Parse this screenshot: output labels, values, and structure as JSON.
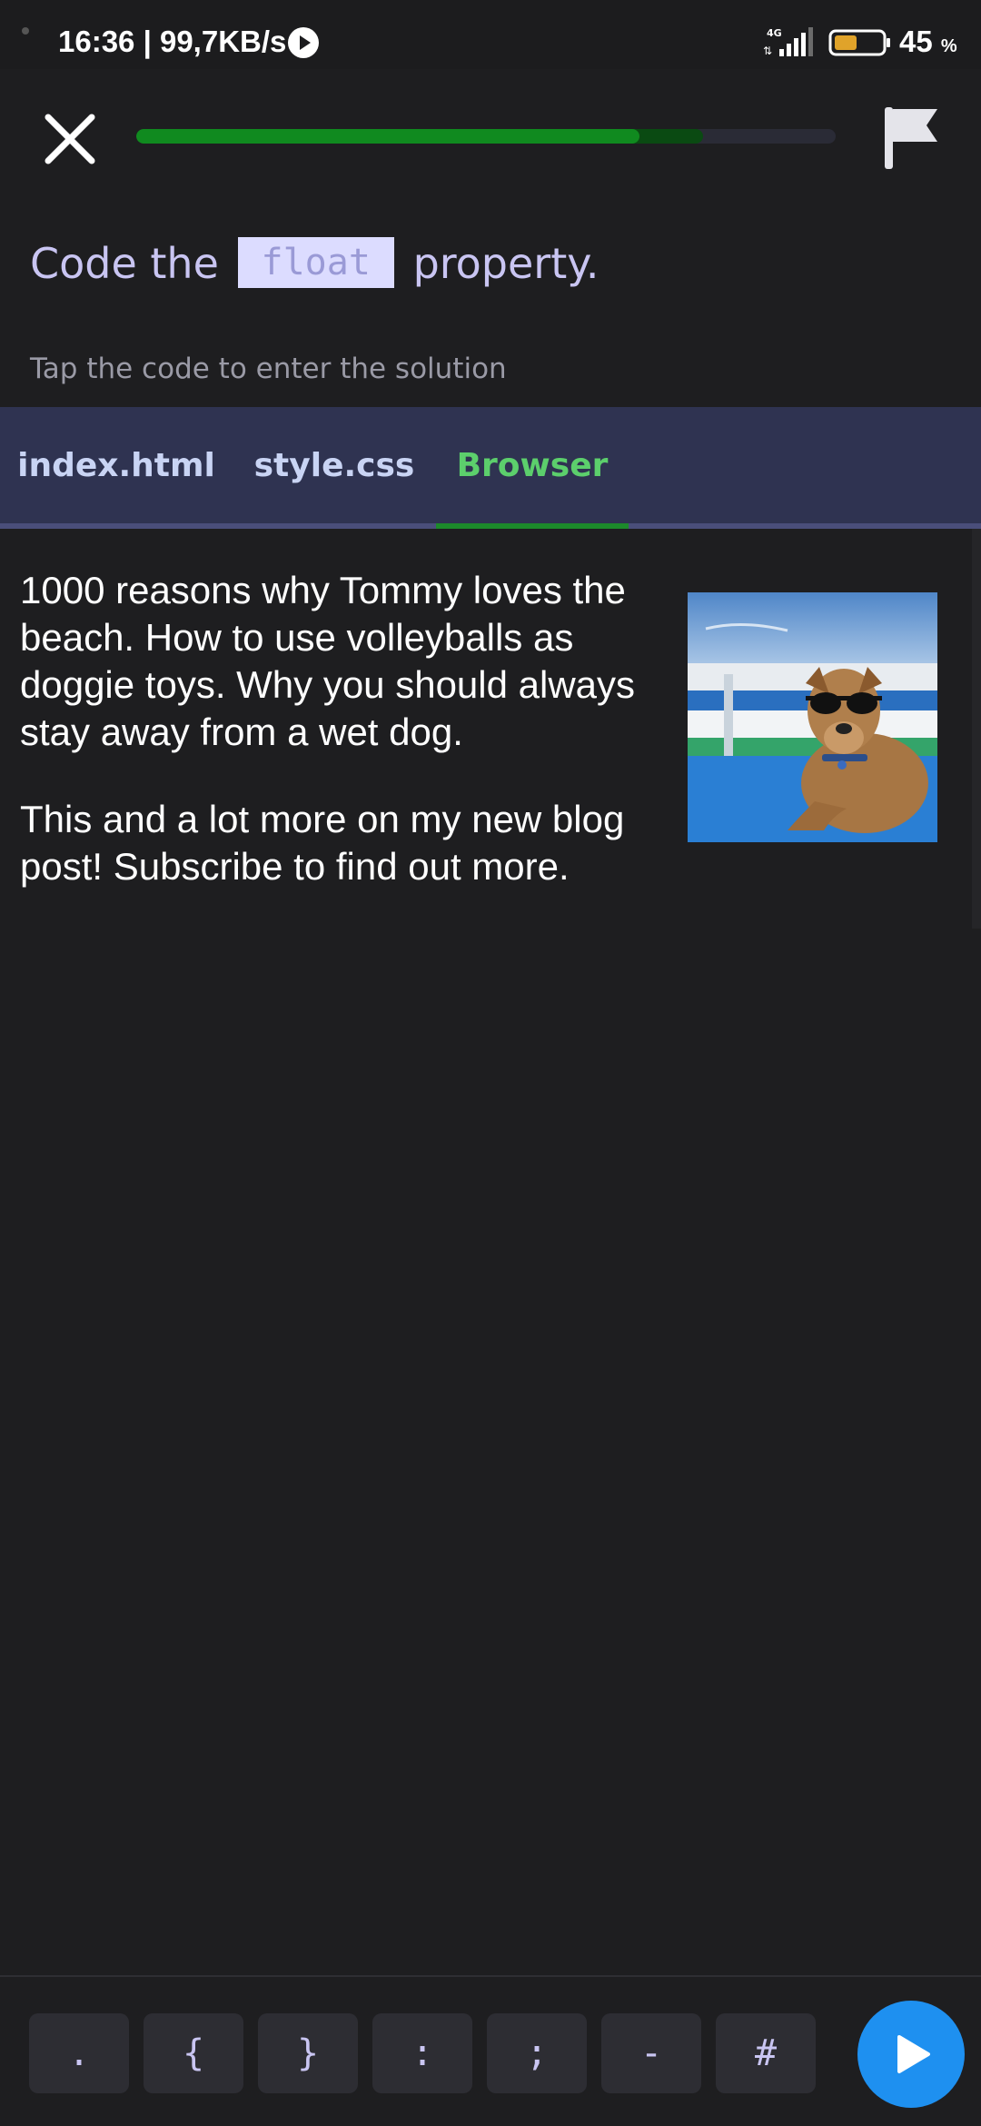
{
  "status_bar": {
    "time_text": "16:36 | 99,7KB/s",
    "network_label": "4G",
    "battery_percent": "45",
    "battery_unit": "%"
  },
  "toolbar": {
    "progress_fraction": 0.72,
    "progress_secondary_fraction": 0.81,
    "accent_color": "#108a1f"
  },
  "question": {
    "prefix": "Code the",
    "code": "float",
    "suffix": "property."
  },
  "hint": "Tap the code to enter the solution",
  "tabs": [
    {
      "label": "index.html",
      "active": false
    },
    {
      "label": "style.css",
      "active": false
    },
    {
      "label": "Browser",
      "active": true
    }
  ],
  "browser": {
    "paragraphs": [
      "1000 reasons why Tommy loves the beach. How to use volleyballs as doggie toys. Why you should always stay away from a wet dog.",
      "This and a lot more on my new blog post! Subscribe to find out more."
    ]
  },
  "keyboard": {
    "keys": [
      ".",
      "{",
      "}",
      ":",
      ";",
      "-",
      "#"
    ],
    "run_color": "#1e90f0"
  }
}
